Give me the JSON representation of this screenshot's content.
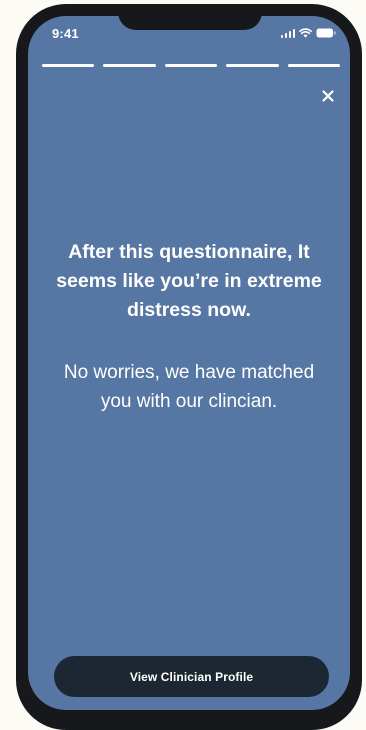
{
  "status_bar": {
    "time": "9:41",
    "icons": [
      "signal-icon",
      "wifi-icon",
      "battery-icon"
    ]
  },
  "progress": {
    "total_steps": 5,
    "completed_steps": 5
  },
  "close": {
    "icon": "close-icon"
  },
  "content": {
    "headline": "After this questionnaire, It seems like you’re in extreme distress now.",
    "message": "No worries, we have matched you with our clincian."
  },
  "cta": {
    "label": "View Clinician Profile"
  },
  "colors": {
    "background": "#5676a3",
    "frame": "#16181c",
    "button": "#1d2733",
    "text": "#ffffff",
    "page": "#fdfbf5"
  }
}
